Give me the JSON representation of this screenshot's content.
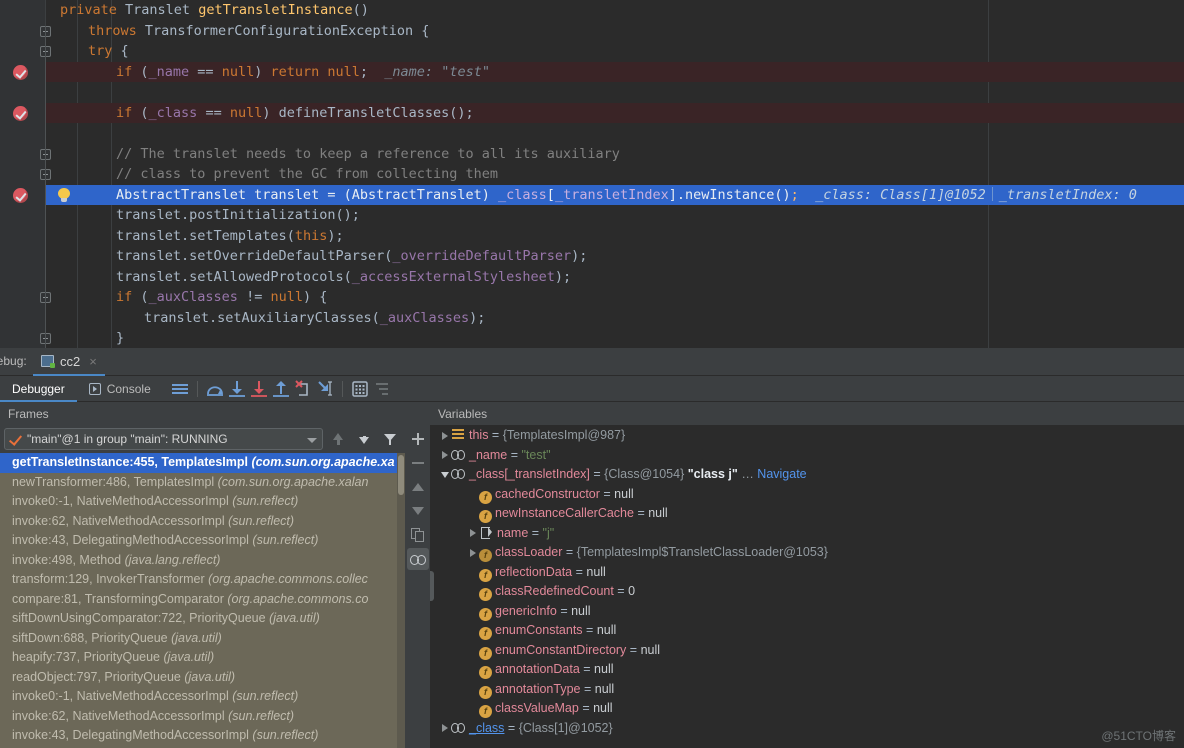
{
  "editor": {
    "lines": [
      {
        "indent": 60,
        "gutter": null,
        "bg": "none",
        "tokens": [
          {
            "t": "private ",
            "c": "k"
          },
          {
            "t": "Translet ",
            "c": "cls"
          },
          {
            "t": "getTransletInstance",
            "c": "mth"
          },
          {
            "t": "()",
            "c": "pn"
          }
        ]
      },
      {
        "indent": 88,
        "gutter": "fold-minus",
        "bg": "none",
        "tokens": [
          {
            "t": "throws ",
            "c": "k"
          },
          {
            "t": "TransformerConfigurationException {",
            "c": "cls"
          }
        ]
      },
      {
        "indent": 88,
        "gutter": "fold-minus",
        "bg": "none",
        "tokens": [
          {
            "t": "try ",
            "c": "k"
          },
          {
            "t": "{",
            "c": "pn"
          }
        ]
      },
      {
        "indent": 116,
        "gutter": "breakpoint",
        "bg": "bp",
        "tokens": [
          {
            "t": "if ",
            "c": "k"
          },
          {
            "t": "(",
            "c": "pn"
          },
          {
            "t": "_name",
            "c": "fld"
          },
          {
            "t": " == ",
            "c": "pn"
          },
          {
            "t": "null",
            "c": "k"
          },
          {
            "t": ") ",
            "c": "pn"
          },
          {
            "t": "return ",
            "c": "k"
          },
          {
            "t": "null",
            "c": "k"
          },
          {
            "t": ";",
            "c": "pn"
          },
          {
            "t": "  _name: ",
            "c": "inl"
          },
          {
            "t": "\"test\"",
            "c": "inl"
          }
        ]
      },
      {
        "indent": 116,
        "gutter": null,
        "bg": "none",
        "tokens": []
      },
      {
        "indent": 116,
        "gutter": "breakpoint",
        "bg": "bp",
        "tokens": [
          {
            "t": "if ",
            "c": "k"
          },
          {
            "t": "(",
            "c": "pn"
          },
          {
            "t": "_class",
            "c": "fld"
          },
          {
            "t": " == ",
            "c": "pn"
          },
          {
            "t": "null",
            "c": "k"
          },
          {
            "t": ") ",
            "c": "pn"
          },
          {
            "t": "defineTransletClasses",
            "c": "cls"
          },
          {
            "t": "();",
            "c": "pn"
          }
        ]
      },
      {
        "indent": 116,
        "gutter": null,
        "bg": "none",
        "tokens": []
      },
      {
        "indent": 116,
        "gutter": "fold-minus",
        "bg": "none",
        "tokens": [
          {
            "t": "// The translet needs to keep a reference to all its auxiliary",
            "c": "cm"
          }
        ]
      },
      {
        "indent": 116,
        "gutter": "fold-end",
        "bg": "none",
        "tokens": [
          {
            "t": "// class to prevent the GC from collecting them",
            "c": "cm"
          }
        ]
      },
      {
        "indent": 116,
        "gutter": "breakpoint-bulb",
        "bg": "exec",
        "tokens": [
          {
            "t": "AbstractTranslet translet = (AbstractTranslet) ",
            "c": "pn"
          },
          {
            "t": "_class",
            "c": "fld"
          },
          {
            "t": "[",
            "c": "pn"
          },
          {
            "t": "_transletIndex",
            "c": "fld"
          },
          {
            "t": "].newInstance",
            "c": "pn"
          },
          {
            "t": "()",
            "c": "pn"
          },
          {
            "t": ";",
            "c": "k"
          }
        ],
        "inline": [
          {
            "label": "_class: Class[1]@1052"
          },
          {
            "label": "_transletIndex: 0"
          }
        ]
      },
      {
        "indent": 116,
        "gutter": null,
        "bg": "none",
        "tokens": [
          {
            "t": "translet.postInitialization",
            "c": "pn"
          },
          {
            "t": "();",
            "c": "pn"
          }
        ]
      },
      {
        "indent": 116,
        "gutter": null,
        "bg": "none",
        "tokens": [
          {
            "t": "translet.setTemplates",
            "c": "pn"
          },
          {
            "t": "(",
            "c": "pn"
          },
          {
            "t": "this",
            "c": "k"
          },
          {
            "t": ");",
            "c": "pn"
          }
        ]
      },
      {
        "indent": 116,
        "gutter": null,
        "bg": "none",
        "tokens": [
          {
            "t": "translet.setOverrideDefaultParser",
            "c": "pn"
          },
          {
            "t": "(",
            "c": "pn"
          },
          {
            "t": "_overrideDefaultParser",
            "c": "fld"
          },
          {
            "t": ");",
            "c": "pn"
          }
        ]
      },
      {
        "indent": 116,
        "gutter": null,
        "bg": "none",
        "tokens": [
          {
            "t": "translet.setAllowedProtocols",
            "c": "pn"
          },
          {
            "t": "(",
            "c": "pn"
          },
          {
            "t": "_accessExternalStylesheet",
            "c": "fld"
          },
          {
            "t": ");",
            "c": "pn"
          }
        ]
      },
      {
        "indent": 116,
        "gutter": "fold-minus",
        "bg": "none",
        "tokens": [
          {
            "t": "if ",
            "c": "k"
          },
          {
            "t": "(",
            "c": "pn"
          },
          {
            "t": "_auxClasses",
            "c": "fld"
          },
          {
            "t": " != ",
            "c": "pn"
          },
          {
            "t": "null",
            "c": "k"
          },
          {
            "t": ") {",
            "c": "pn"
          }
        ]
      },
      {
        "indent": 144,
        "gutter": null,
        "bg": "none",
        "tokens": [
          {
            "t": "translet.setAuxiliaryClasses",
            "c": "pn"
          },
          {
            "t": "(",
            "c": "pn"
          },
          {
            "t": "_auxClasses",
            "c": "fld"
          },
          {
            "t": ");",
            "c": "pn"
          }
        ]
      },
      {
        "indent": 116,
        "gutter": "fold-end",
        "bg": "none",
        "tokens": [
          {
            "t": "}",
            "c": "pn"
          }
        ]
      }
    ]
  },
  "debug_window": {
    "label": "Debug:",
    "tab": {
      "title": "cc2",
      "close": "×",
      "icon": "run-configuration-icon"
    },
    "toolbar": {
      "tabs": [
        {
          "label": "Debugger",
          "active": true
        },
        {
          "label": "Console",
          "active": false,
          "icon": "console-icon"
        }
      ],
      "buttons": [
        {
          "name": "show-execution-point-icon",
          "title": "Show Execution Point"
        },
        {
          "name": "step-over-icon",
          "title": "Step Over"
        },
        {
          "name": "step-into-icon",
          "title": "Step Into"
        },
        {
          "name": "force-step-into-icon",
          "title": "Force Step Into"
        },
        {
          "name": "step-out-icon",
          "title": "Step Out"
        },
        {
          "name": "drop-frame-icon",
          "title": "Drop Frame"
        },
        {
          "name": "run-to-cursor-icon",
          "title": "Run to Cursor"
        },
        {
          "name": "evaluate-expression-icon",
          "title": "Evaluate Expression"
        },
        {
          "name": "mute-breakpoints-icon",
          "title": "Mute Breakpoints"
        }
      ]
    }
  },
  "frames": {
    "header": "Frames",
    "thread": "\"main\"@1 in group \"main\": RUNNING",
    "items": [
      {
        "method": "getTransletInstance:455, TemplatesImpl ",
        "pkg": "(com.sun.org.apache.xa",
        "selected": true
      },
      {
        "method": "newTransformer:486, TemplatesImpl ",
        "pkg": "(com.sun.org.apache.xalan",
        "selected": false
      },
      {
        "method": "invoke0:-1, NativeMethodAccessorImpl ",
        "pkg": "(sun.reflect)",
        "selected": false
      },
      {
        "method": "invoke:62, NativeMethodAccessorImpl ",
        "pkg": "(sun.reflect)",
        "selected": false
      },
      {
        "method": "invoke:43, DelegatingMethodAccessorImpl ",
        "pkg": "(sun.reflect)",
        "selected": false
      },
      {
        "method": "invoke:498, Method ",
        "pkg": "(java.lang.reflect)",
        "selected": false
      },
      {
        "method": "transform:129, InvokerTransformer ",
        "pkg": "(org.apache.commons.collec",
        "selected": false
      },
      {
        "method": "compare:81, TransformingComparator ",
        "pkg": "(org.apache.commons.co",
        "selected": false
      },
      {
        "method": "siftDownUsingComparator:722, PriorityQueue ",
        "pkg": "(java.util)",
        "selected": false
      },
      {
        "method": "siftDown:688, PriorityQueue ",
        "pkg": "(java.util)",
        "selected": false
      },
      {
        "method": "heapify:737, PriorityQueue ",
        "pkg": "(java.util)",
        "selected": false
      },
      {
        "method": "readObject:797, PriorityQueue ",
        "pkg": "(java.util)",
        "selected": false
      },
      {
        "method": "invoke0:-1, NativeMethodAccessorImpl ",
        "pkg": "(sun.reflect)",
        "selected": false
      },
      {
        "method": "invoke:62, NativeMethodAccessorImpl ",
        "pkg": "(sun.reflect)",
        "selected": false
      },
      {
        "method": "invoke:43, DelegatingMethodAccessorImpl ",
        "pkg": "(sun.reflect)",
        "selected": false
      }
    ],
    "nav_buttons": [
      {
        "name": "frame-up-button"
      },
      {
        "name": "frame-down-button"
      },
      {
        "name": "filter-frames-button"
      }
    ]
  },
  "mid_toolbar": [
    {
      "name": "add-watch-button",
      "glyph": "plus"
    },
    {
      "name": "remove-watch-button",
      "glyph": "minus"
    },
    {
      "name": "move-up-button",
      "glyph": "up"
    },
    {
      "name": "move-down-button",
      "glyph": "down"
    },
    {
      "name": "copy-value-button",
      "glyph": "copy"
    },
    {
      "name": "inspect-button",
      "glyph": "glasses",
      "active": true
    }
  ],
  "variables": {
    "header": "Variables",
    "rows": [
      {
        "indent": 0,
        "twisty": "right",
        "icon": "this-icon",
        "name": "this",
        "eq": " = ",
        "value": "{TemplatesImpl@987}",
        "vclass": "v-obj"
      },
      {
        "indent": 0,
        "twisty": "right",
        "icon": "ref-icon",
        "name": "_name",
        "eq": " = ",
        "value": "\"test\"",
        "vclass": "v-str"
      },
      {
        "indent": 0,
        "twisty": "down",
        "icon": "ref-icon",
        "name": "_class[_transletIndex]",
        "eq": " = ",
        "value": "{Class@1054}",
        "vclass": "v-obj",
        "extra_bold": "\"class j\"",
        "dots": " … ",
        "nav": "Navigate"
      },
      {
        "indent": 1,
        "twisty": "none",
        "icon": "field-icon",
        "name": "cachedConstructor",
        "eq": " = ",
        "value": "null",
        "vclass": "v-null"
      },
      {
        "indent": 1,
        "twisty": "none",
        "icon": "field-icon",
        "name": "newInstanceCallerCache",
        "eq": " = ",
        "value": "null",
        "vclass": "v-null"
      },
      {
        "indent": 1,
        "twisty": "right",
        "icon": "string-icon",
        "name": "name",
        "eq": " = ",
        "value": "\"j\"",
        "vclass": "v-str"
      },
      {
        "indent": 1,
        "twisty": "right",
        "icon": "field-cl-icon",
        "name": "classLoader",
        "eq": " = ",
        "value": "{TemplatesImpl$TransletClassLoader@1053}",
        "vclass": "v-obj"
      },
      {
        "indent": 1,
        "twisty": "none",
        "icon": "field-icon",
        "name": "reflectionData",
        "eq": " = ",
        "value": "null",
        "vclass": "v-null"
      },
      {
        "indent": 1,
        "twisty": "none",
        "icon": "field-icon",
        "name": "classRedefinedCount",
        "eq": " = ",
        "value": "0",
        "vclass": "v-num"
      },
      {
        "indent": 1,
        "twisty": "none",
        "icon": "field-icon",
        "name": "genericInfo",
        "eq": " = ",
        "value": "null",
        "vclass": "v-null"
      },
      {
        "indent": 1,
        "twisty": "none",
        "icon": "field-icon",
        "name": "enumConstants",
        "eq": " = ",
        "value": "null",
        "vclass": "v-null"
      },
      {
        "indent": 1,
        "twisty": "none",
        "icon": "field-icon",
        "name": "enumConstantDirectory",
        "eq": " = ",
        "value": "null",
        "vclass": "v-null"
      },
      {
        "indent": 1,
        "twisty": "none",
        "icon": "field-icon",
        "name": "annotationData",
        "eq": " = ",
        "value": "null",
        "vclass": "v-null"
      },
      {
        "indent": 1,
        "twisty": "none",
        "icon": "field-icon",
        "name": "annotationType",
        "eq": " = ",
        "value": "null",
        "vclass": "v-null"
      },
      {
        "indent": 1,
        "twisty": "none",
        "icon": "field-icon",
        "name": "classValueMap",
        "eq": " = ",
        "value": "null",
        "vclass": "v-null"
      },
      {
        "indent": 0,
        "twisty": "right",
        "icon": "ref-icon",
        "name": "_class",
        "name_blue": true,
        "eq": " = ",
        "value": "{Class[1]@1052}",
        "vclass": "v-obj"
      }
    ]
  },
  "watermark": "@51CTO博客"
}
